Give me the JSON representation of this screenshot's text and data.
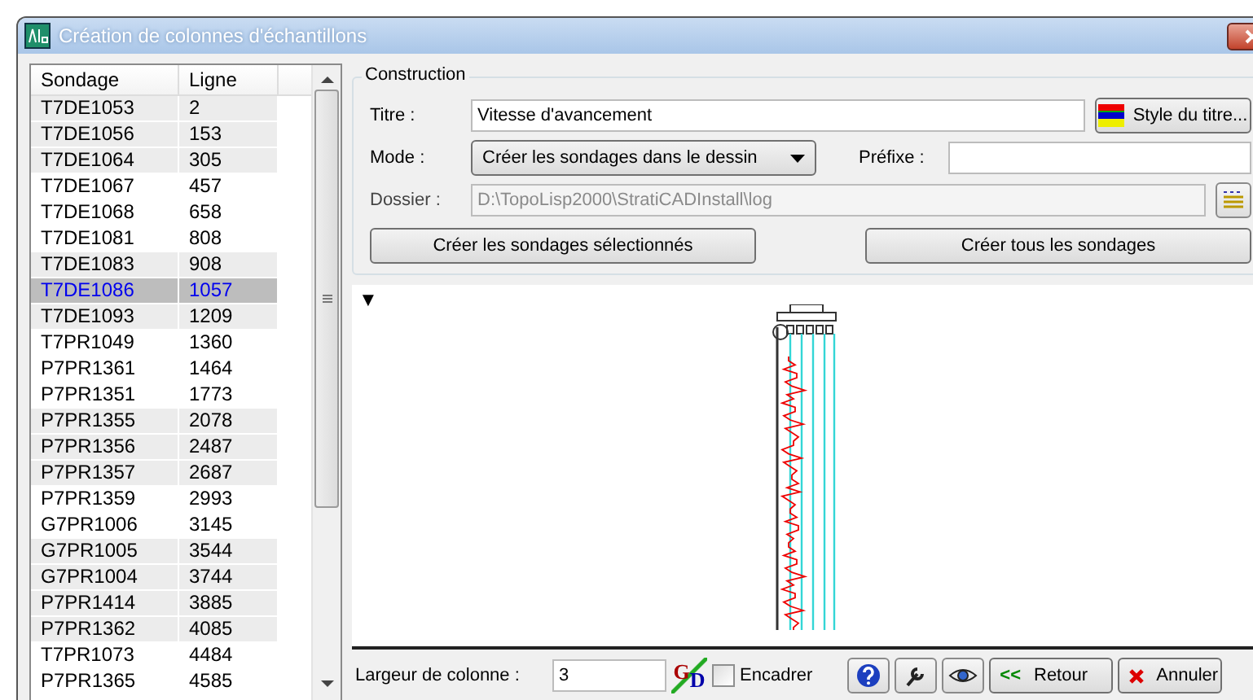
{
  "window": {
    "title": "Création de colonnes d'échantillons"
  },
  "table": {
    "columns": [
      "Sondage",
      "Ligne"
    ],
    "rows": [
      {
        "sondage": "T7DE1053",
        "ligne": "2",
        "shaded": true,
        "selected": false
      },
      {
        "sondage": "T7DE1056",
        "ligne": "153",
        "shaded": true,
        "selected": false
      },
      {
        "sondage": "T7DE1064",
        "ligne": "305",
        "shaded": true,
        "selected": false
      },
      {
        "sondage": "T7DE1067",
        "ligne": "457",
        "shaded": false,
        "selected": false
      },
      {
        "sondage": "T7DE1068",
        "ligne": "658",
        "shaded": false,
        "selected": false
      },
      {
        "sondage": "T7DE1081",
        "ligne": "808",
        "shaded": false,
        "selected": false
      },
      {
        "sondage": "T7DE1083",
        "ligne": "908",
        "shaded": true,
        "selected": false
      },
      {
        "sondage": "T7DE1086",
        "ligne": "1057",
        "shaded": true,
        "selected": true
      },
      {
        "sondage": "T7DE1093",
        "ligne": "1209",
        "shaded": true,
        "selected": false
      },
      {
        "sondage": "T7PR1049",
        "ligne": "1360",
        "shaded": false,
        "selected": false
      },
      {
        "sondage": "P7PR1361",
        "ligne": "1464",
        "shaded": false,
        "selected": false
      },
      {
        "sondage": "P7PR1351",
        "ligne": "1773",
        "shaded": false,
        "selected": false
      },
      {
        "sondage": "P7PR1355",
        "ligne": "2078",
        "shaded": true,
        "selected": false
      },
      {
        "sondage": "P7PR1356",
        "ligne": "2487",
        "shaded": true,
        "selected": false
      },
      {
        "sondage": "P7PR1357",
        "ligne": "2687",
        "shaded": true,
        "selected": false
      },
      {
        "sondage": "P7PR1359",
        "ligne": "2993",
        "shaded": false,
        "selected": false
      },
      {
        "sondage": "G7PR1006",
        "ligne": "3145",
        "shaded": false,
        "selected": false
      },
      {
        "sondage": "G7PR1005",
        "ligne": "3544",
        "shaded": true,
        "selected": false
      },
      {
        "sondage": "G7PR1004",
        "ligne": "3744",
        "shaded": true,
        "selected": false
      },
      {
        "sondage": "P7PR1414",
        "ligne": "3885",
        "shaded": true,
        "selected": false
      },
      {
        "sondage": "P7PR1362",
        "ligne": "4085",
        "shaded": true,
        "selected": false
      },
      {
        "sondage": "T7PR1073",
        "ligne": "4484",
        "shaded": false,
        "selected": false
      },
      {
        "sondage": "P7PR1365",
        "ligne": "4585",
        "shaded": false,
        "selected": false
      }
    ]
  },
  "construction": {
    "legend": "Construction",
    "titre": {
      "label": "Titre :",
      "value": "Vitesse d'avancement"
    },
    "style_button": "Style du titre...",
    "mode": {
      "label": "Mode :",
      "value": "Créer les sondages dans le dessin"
    },
    "prefixe": {
      "label": "Préfixe :"
    },
    "dossier": {
      "label": "Dossier :",
      "value": "D:\\TopoLisp2000\\StratiCADInstall\\log",
      "disabled": true
    },
    "buttons": [
      "Créer les sondages sélectionnés",
      "Créer tous les sondages"
    ]
  },
  "preview": {
    "marker": "▼"
  },
  "footer": {
    "largeur_label": "Largeur de colonne :",
    "largeur_value": "3",
    "gd_icon": "GD",
    "encadrer": {
      "label": "Encadrer",
      "checked": false
    },
    "retour": {
      "arrow": "<<",
      "label": "Retour"
    },
    "annuler": {
      "label": "Annuler"
    }
  }
}
